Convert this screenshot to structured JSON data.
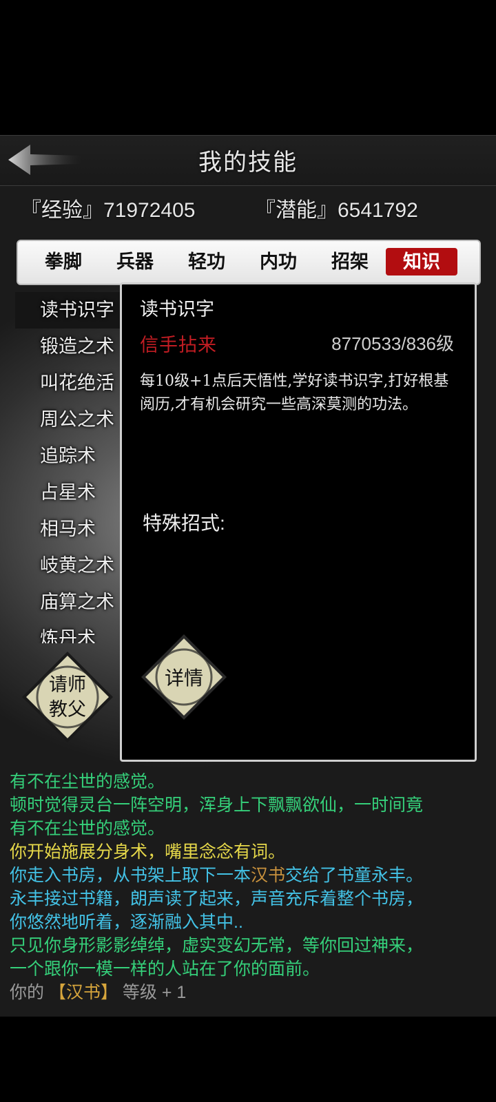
{
  "header": {
    "title": "我的技能"
  },
  "stats": {
    "exp_label": "『经验』71972405",
    "pot_label": "『潜能』6541792"
  },
  "tabs": [
    {
      "label": "拳脚"
    },
    {
      "label": "兵器"
    },
    {
      "label": "轻功"
    },
    {
      "label": "内功"
    },
    {
      "label": "招架"
    },
    {
      "label": "知识",
      "active": true
    }
  ],
  "skills": [
    {
      "label": "读书识字"
    },
    {
      "label": "锻造之术"
    },
    {
      "label": "叫花绝活"
    },
    {
      "label": "周公之术"
    },
    {
      "label": "追踪术"
    },
    {
      "label": "占星术"
    },
    {
      "label": "相马术"
    },
    {
      "label": "岐黄之术"
    },
    {
      "label": "庙算之术"
    },
    {
      "label": "炼丹术"
    }
  ],
  "buttons": {
    "mentor_line1": "请师",
    "mentor_line2": "教父",
    "details": "详情"
  },
  "detail": {
    "name": "读书识字",
    "rank": "信手拈来",
    "level": "8770533/836级",
    "description": "每10级+1点后天悟性,学好读书识字,打好根基阅历,才有机会研究一些高深莫测的功法。",
    "special_label": "特殊招式:"
  },
  "log": {
    "l1": "有不在尘世的感觉。",
    "l2": "顿时觉得灵台一阵空明，浑身上下飘飘欲仙，一时间竟",
    "l3": "有不在尘世的感觉。",
    "l4": "你开始施展分身术，嘴里念念有词。",
    "l5a": "你走入书房，从书架上取下一本",
    "l5b": "汉书",
    "l5c": "交给了书童永丰。",
    "l6": "永丰接过书籍，朗声读了起来，声音充斥着整个书房，",
    "l7": "你悠然地听着，逐渐融入其中..",
    "l8": "只见你身形影影绰绰，虚实变幻无常，等你回过神来，",
    "l9": "一个跟你一模一样的人站在了你的面前。",
    "l10a": "你的 ",
    "l10b": "【汉书】",
    "l10c": " 等级 + 1"
  },
  "colors": {
    "active_tab": "#b20d10",
    "rank_red": "#c21d23",
    "log_green": "#35d07a",
    "log_yellow": "#e7d94a",
    "log_cyan": "#43c2e6",
    "log_gold": "#c8913d"
  }
}
